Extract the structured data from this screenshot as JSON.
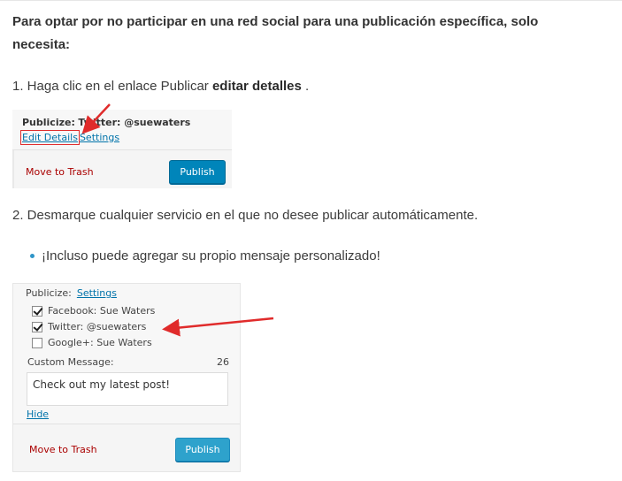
{
  "intro": "Para optar por no participar en una red social para una publicación específica, solo necesita:",
  "step1": {
    "prefix": "1. Haga clic en el enlace Publicar ",
    "bold": "editar detalles",
    "suffix": " ."
  },
  "step2": "2. Desmarque cualquier servicio en el que no desee publicar automáticamente.",
  "bullet": "¡Incluso puede agregar su propio mensaje personalizado!",
  "shot1": {
    "publicize_label": "Publicize:",
    "publicize_value": "Twitter: @suewaters",
    "edit_details": "Edit Details",
    "settings": "Settings",
    "move_to_trash": "Move to Trash",
    "publish": "Publish"
  },
  "shot2": {
    "publicize_label": "Publicize:",
    "settings": "Settings",
    "services": [
      {
        "label": "Facebook: Sue Waters",
        "checked": true
      },
      {
        "label": "Twitter: @suewaters",
        "checked": true
      },
      {
        "label": "Google+: Sue Waters",
        "checked": false
      }
    ],
    "custom_message_label": "Custom Message:",
    "custom_message_count": "26",
    "custom_message_text": "Check out my latest post!",
    "hide": "Hide",
    "move_to_trash": "Move to Trash",
    "publish": "Publish"
  },
  "colors": {
    "link": "#0073aa",
    "trash": "#aa0000",
    "publish_button": "#0085ba",
    "annotation_arrow": "#e02b2b"
  }
}
